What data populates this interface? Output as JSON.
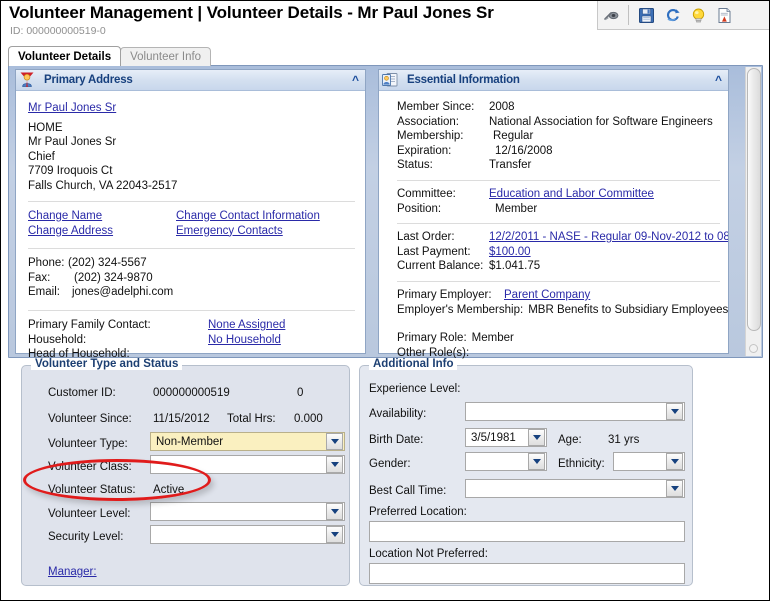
{
  "header": {
    "title": "Volunteer Management  |  Volunteer Details - Mr Paul Jones Sr",
    "record_id": "ID: 000000000519-0"
  },
  "toolbar": {
    "items": [
      {
        "name": "view-hide-icon",
        "glyph": "✒",
        "title": "Hide"
      },
      {
        "name": "save-icon",
        "glyph": "ὋE",
        "title": "Save"
      },
      {
        "name": "refresh-icon",
        "glyph": "↻",
        "title": "Refresh"
      },
      {
        "name": "hint-icon",
        "glyph": "Ὂ1",
        "title": "Hint"
      },
      {
        "name": "report-icon",
        "glyph": "Ὄ4",
        "title": "Report"
      }
    ]
  },
  "tabs": [
    {
      "label": "Volunteer Details",
      "active": true
    },
    {
      "label": "Volunteer Info",
      "active": false
    }
  ],
  "primary_address": {
    "title": "Primary Address",
    "name_link": "Mr Paul Jones Sr",
    "address_lines": [
      "HOME",
      "Mr Paul Jones Sr",
      "Chief",
      "7709 Iroquois Ct",
      "Falls Church, VA 22043-2517"
    ],
    "links_left": [
      "Change Name",
      "Change Address"
    ],
    "links_right": [
      "Change Contact Information",
      "Emergency Contacts"
    ],
    "contact": [
      {
        "label": "Phone:",
        "value": "(202) 324-5567"
      },
      {
        "label": "Fax:",
        "value": "(202) 324-9870"
      },
      {
        "label": "Email:",
        "value": "jones@adelphi.com"
      }
    ],
    "household": [
      {
        "label": "Primary Family Contact:",
        "link": "None Assigned"
      },
      {
        "label": "Household:",
        "link": "No Household"
      },
      {
        "label": "Head of Household:",
        "link": ""
      }
    ]
  },
  "essential_information": {
    "title": "Essential Information",
    "block1": [
      {
        "label": "Member Since:",
        "value": "2008"
      },
      {
        "label": "Association:",
        "value": "National Association for Software Engineers"
      },
      {
        "label": "Membership:",
        "value": "Regular"
      },
      {
        "label": "Expiration:",
        "value": "12/16/2008"
      },
      {
        "label": "Status:",
        "value": "Transfer"
      }
    ],
    "block2": [
      {
        "label": "Committee:",
        "value": "Education and Labor Committee",
        "link": true
      },
      {
        "label": "Position:",
        "value": "Member",
        "link": false
      }
    ],
    "block3": [
      {
        "label": "Last Order:",
        "value": "12/2/2011 - NASE - Regular 09-Nov-2012 to 08-",
        "link": true
      },
      {
        "label": "Last Payment:",
        "value": "$100.00",
        "link": true
      },
      {
        "label": "Current Balance:",
        "value": "$1.041.75",
        "link": false
      }
    ],
    "block4": [
      {
        "label": "Primary Employer:",
        "value": "Parent Company",
        "link": true
      },
      {
        "label": "Employer's Membership:",
        "value": "MBR Benefits to Subsidiary Employees",
        "link": false
      }
    ],
    "block5": [
      {
        "label": "Primary Role:",
        "value": "Member"
      },
      {
        "label": "Other Role(s):",
        "value": ""
      }
    ]
  },
  "volunteer_type_and_status": {
    "legend": "Volunteer Type and Status",
    "customer_id_label": "Customer ID:",
    "customer_id_value": "000000000519",
    "customer_id_suffix": "0",
    "volunteer_since_label": "Volunteer Since:",
    "volunteer_since_value": "11/15/2012",
    "total_hrs_label": "Total Hrs:",
    "total_hrs_value": "0.000",
    "volunteer_type_label": "Volunteer Type:",
    "volunteer_type_value": "Non-Member",
    "volunteer_class_label": "Volunteer Class:",
    "volunteer_class_value": "",
    "volunteer_status_label": "Volunteer Status:",
    "volunteer_status_value": "Active",
    "volunteer_level_label": "Volunteer Level:",
    "volunteer_level_value": "",
    "security_level_label": "Security Level:",
    "security_level_value": "",
    "manager_link": "Manager:"
  },
  "additional_info": {
    "legend": "Additional Info",
    "experience_level_label": "Experience Level:",
    "experience_level_value": "",
    "availability_label": "Availability:",
    "availability_value": "",
    "birth_date_label": "Birth Date:",
    "birth_date_value": "3/5/1981",
    "age_label": "Age:",
    "age_value": "31 yrs",
    "gender_label": "Gender:",
    "gender_value": "",
    "ethnicity_label": "Ethnicity:",
    "ethnicity_value": "",
    "best_call_time_label": "Best Call Time:",
    "best_call_time_value": "",
    "preferred_location_label": "Preferred Location:",
    "preferred_location_value": "",
    "location_not_preferred_label": "Location Not Preferred:",
    "location_not_preferred_value": ""
  },
  "annotation": {
    "name": "red-ellipse-highlight",
    "color": "#e01b1b",
    "targets": "Volunteer Status: Active"
  }
}
